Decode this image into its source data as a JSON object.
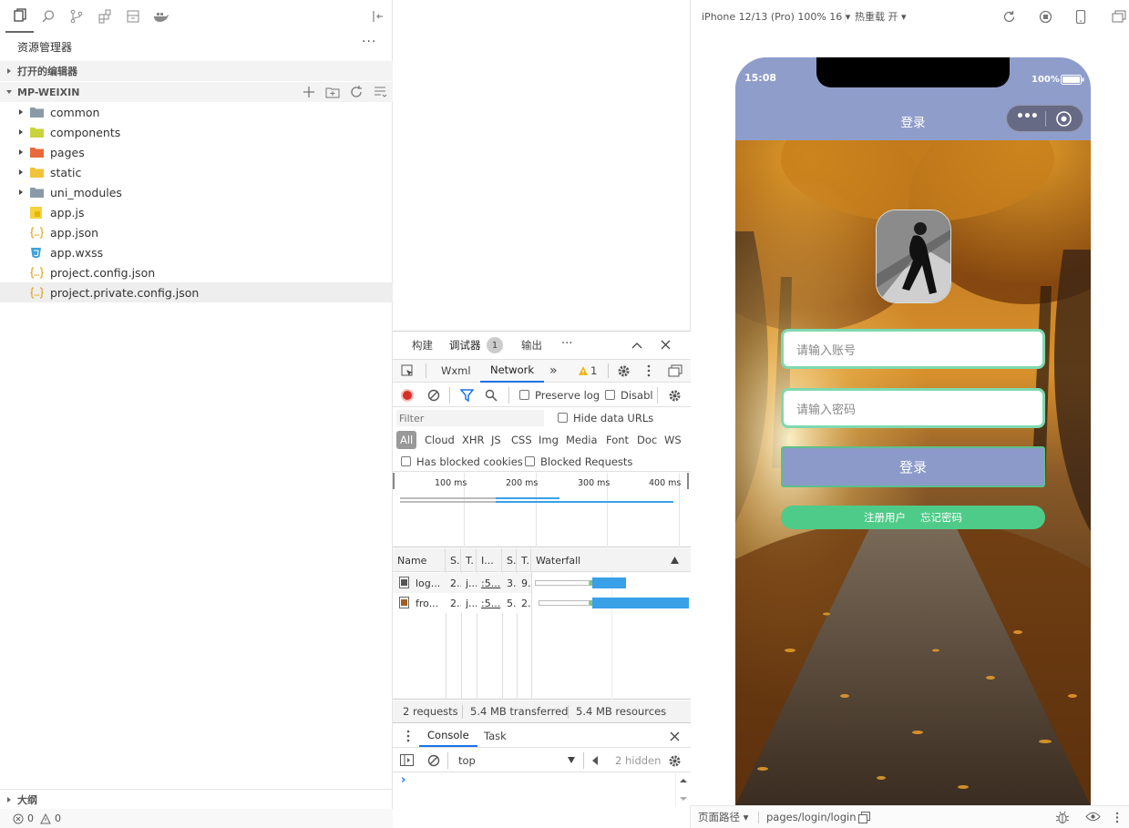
{
  "explorer": {
    "title": "资源管理器",
    "more": "···",
    "open_editors": "打开的编辑器",
    "project": "MP-WEIXIN",
    "items": [
      {
        "label": "common",
        "kind": "folder"
      },
      {
        "label": "components",
        "kind": "folder"
      },
      {
        "label": "pages",
        "kind": "folder"
      },
      {
        "label": "static",
        "kind": "folder"
      },
      {
        "label": "uni_modules",
        "kind": "folder"
      },
      {
        "label": "app.js",
        "kind": "js"
      },
      {
        "label": "app.json",
        "kind": "json"
      },
      {
        "label": "app.wxss",
        "kind": "wxss"
      },
      {
        "label": "project.config.json",
        "kind": "json"
      },
      {
        "label": "project.private.config.json",
        "kind": "json"
      }
    ],
    "outline": "大纲",
    "errors": "0",
    "warnings": "0"
  },
  "devtools": {
    "tabs": [
      "构建",
      "调试器",
      "输出"
    ],
    "debugger_badge": "1",
    "more": "···",
    "panel_tabs": [
      "Wxml",
      "Network"
    ],
    "overflow": "»",
    "warn_count": "1",
    "preserve_log": "Preserve log",
    "disable_cache": "Disabl",
    "filter_placeholder": "Filter",
    "hide_data_urls": "Hide data URLs",
    "types": [
      "All",
      "Cloud",
      "XHR",
      "JS",
      "CSS",
      "Img",
      "Media",
      "Font",
      "Doc",
      "WS"
    ],
    "has_blocked_cookies": "Has blocked cookies",
    "blocked_requests": "Blocked Requests",
    "timeline_ticks": [
      "100 ms",
      "200 ms",
      "300 ms",
      "400 ms"
    ],
    "columns": [
      "Name",
      "S.",
      "T.",
      "I...",
      "S.",
      "T.",
      "Waterfall"
    ],
    "requests": [
      {
        "name": "log...",
        "status": "2..",
        "type": "j...",
        "initiator": ":5...",
        "size": "3..",
        "time": "9.."
      },
      {
        "name": "fro...",
        "status": "2..",
        "type": "j...",
        "initiator": ":5...",
        "size": "5..",
        "time": "2.."
      }
    ],
    "summary": {
      "requests": "2 requests",
      "transferred": "5.4 MB transferred",
      "resources": "5.4 MB resources"
    },
    "drawer_tabs": [
      "Console",
      "Task"
    ],
    "context": "top",
    "hidden": "2 hidden",
    "prompt": "›"
  },
  "simulator": {
    "device": "iPhone 12/13 (Pro) 100% 16 ▾",
    "hot_reload": "热重载 开 ▾",
    "time": "15:08",
    "battery": "100%",
    "nav_title": "登录",
    "capsule_dots": "•••",
    "account_placeholder": "请输入账号",
    "password_placeholder": "请输入密码",
    "login_button": "登录",
    "register": "注册用户",
    "forgot": "忘记密码",
    "page_path_label": "页面路径 ▾",
    "page_path": "pages/login/login"
  },
  "colors": {
    "nav_bg": "#8f9dcb",
    "login_btn": "#8b9ac9",
    "link_bar": "#4ecb88",
    "input_border": "#7ed9b0",
    "accent_blue": "#1a73e8",
    "record_red": "#d93025"
  }
}
